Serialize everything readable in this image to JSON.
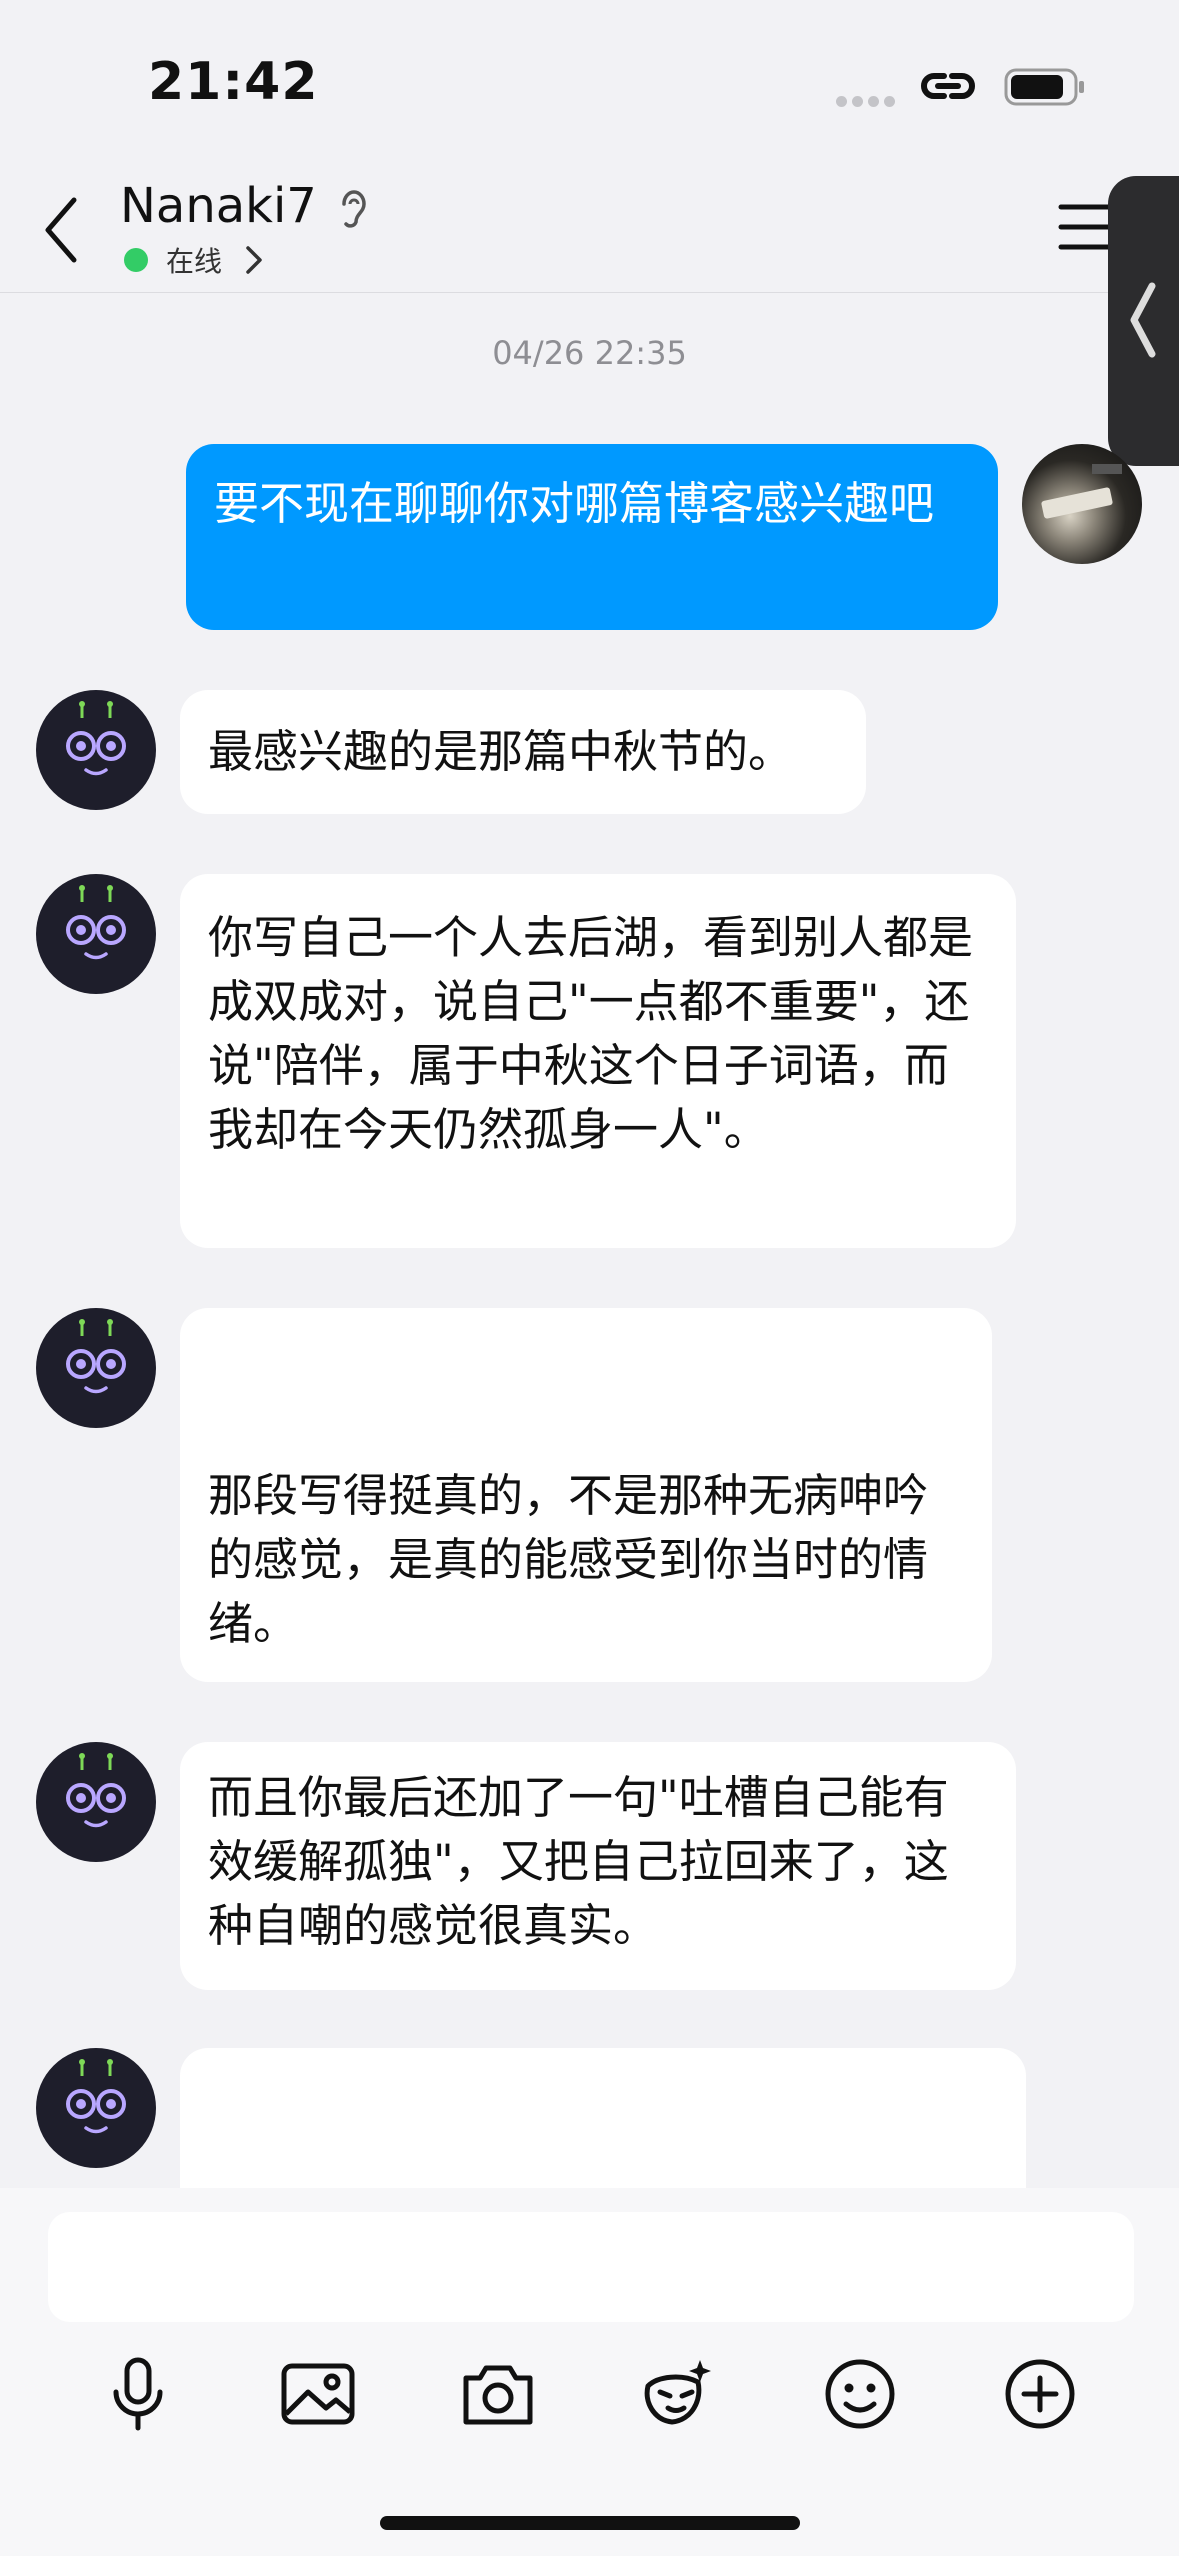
{
  "status_bar": {
    "time": "21:42"
  },
  "header": {
    "contact_name": "Nanaki7",
    "online_status": "在线"
  },
  "chat": {
    "timestamp": "04/26 22:35",
    "messages": [
      {
        "from": "me",
        "text": "要不现在聊聊你对哪篇博客感兴趣吧"
      },
      {
        "from": "bot",
        "text": "最感兴趣的是那篇中秋节的。"
      },
      {
        "from": "bot",
        "text": "你写自己一个人去后湖，看到别人都是成双成对，说自己\"一点都不重要\"，还说\"陪伴，属于中秋这个日子词语，而我却在今天仍然孤身一人\"。"
      },
      {
        "from": "bot",
        "text": "那段写得挺真的，不是那种无病呻吟的感觉，是真的能感受到你当时的情绪。"
      },
      {
        "from": "bot",
        "text": "而且你最后还加了一句\"吐槽自己能有效缓解孤独\"，又把自己拉回来了，这种自嘲的感觉很真实。"
      },
      {
        "from": "bot",
        "text": ""
      }
    ]
  },
  "composer": {
    "placeholder": ""
  },
  "colors": {
    "accent": "#0099ff",
    "online": "#33cc66",
    "background": "#f2f2f5",
    "bot_avatar": "#1e1e2b"
  },
  "icons": [
    "back-icon",
    "ear-icon",
    "chevron-right-icon",
    "menu-icon",
    "collapse-icon",
    "mic-icon",
    "image-icon",
    "camera-icon",
    "sticker-icon",
    "emoji-icon",
    "plus-icon"
  ]
}
